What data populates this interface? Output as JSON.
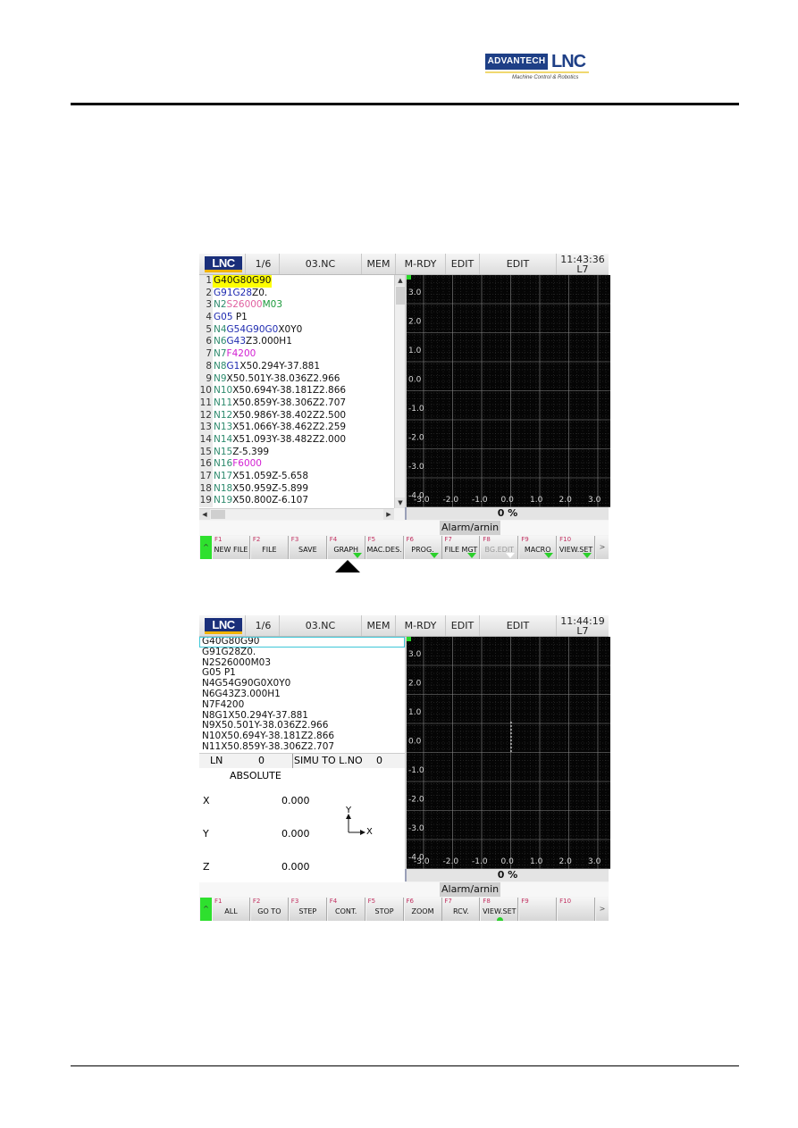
{
  "page": {
    "brand": {
      "company": "ADVANTECH",
      "product": "LNC",
      "tagline": "Machine Control & Robotics"
    }
  },
  "screen1": {
    "topbar": {
      "page": "1/6",
      "file": "03.NC",
      "source": "MEM",
      "status": "M-RDY",
      "mode": "EDIT",
      "mode_detail": "EDIT",
      "time": "11:43:36",
      "line": "L7"
    },
    "program": [
      {
        "no": "1",
        "tokens": [
          {
            "t": "G40G80G90",
            "c": "x"
          }
        ],
        "selected": true
      },
      {
        "no": "2",
        "tokens": [
          {
            "t": "G91G28",
            "c": "g"
          },
          {
            "t": "Z0.",
            "c": "x"
          }
        ]
      },
      {
        "no": "3",
        "tokens": [
          {
            "t": "N2",
            "c": "n"
          },
          {
            "t": "S26000",
            "c": "s"
          },
          {
            "t": "M03",
            "c": "m"
          }
        ]
      },
      {
        "no": "4",
        "tokens": [
          {
            "t": "G05 ",
            "c": "g"
          },
          {
            "t": "P1",
            "c": "x"
          }
        ]
      },
      {
        "no": "5",
        "tokens": [
          {
            "t": "N4",
            "c": "n"
          },
          {
            "t": "G54G90G0",
            "c": "g"
          },
          {
            "t": "X0Y0",
            "c": "x"
          }
        ]
      },
      {
        "no": "6",
        "tokens": [
          {
            "t": "N6",
            "c": "n"
          },
          {
            "t": "G43",
            "c": "g"
          },
          {
            "t": "Z3.000H1",
            "c": "x"
          }
        ]
      },
      {
        "no": "7",
        "tokens": [
          {
            "t": "N7",
            "c": "n"
          },
          {
            "t": "F4200",
            "c": "f"
          }
        ]
      },
      {
        "no": "8",
        "tokens": [
          {
            "t": "N8",
            "c": "n"
          },
          {
            "t": "G1",
            "c": "g"
          },
          {
            "t": "X50.294Y-37.881",
            "c": "x"
          }
        ]
      },
      {
        "no": "9",
        "tokens": [
          {
            "t": "N9",
            "c": "n"
          },
          {
            "t": "X50.501Y-38.036Z2.966",
            "c": "x"
          }
        ]
      },
      {
        "no": "10",
        "tokens": [
          {
            "t": "N10",
            "c": "n"
          },
          {
            "t": "X50.694Y-38.181Z2.866",
            "c": "x"
          }
        ]
      },
      {
        "no": "11",
        "tokens": [
          {
            "t": "N11",
            "c": "n"
          },
          {
            "t": "X50.859Y-38.306Z2.707",
            "c": "x"
          }
        ]
      },
      {
        "no": "12",
        "tokens": [
          {
            "t": "N12",
            "c": "n"
          },
          {
            "t": "X50.986Y-38.402Z2.500",
            "c": "x"
          }
        ]
      },
      {
        "no": "13",
        "tokens": [
          {
            "t": "N13",
            "c": "n"
          },
          {
            "t": "X51.066Y-38.462Z2.259",
            "c": "x"
          }
        ]
      },
      {
        "no": "14",
        "tokens": [
          {
            "t": "N14",
            "c": "n"
          },
          {
            "t": "X51.093Y-38.482Z2.000",
            "c": "x"
          }
        ]
      },
      {
        "no": "15",
        "tokens": [
          {
            "t": "N15",
            "c": "n"
          },
          {
            "t": "Z-5.399",
            "c": "x"
          }
        ]
      },
      {
        "no": "16",
        "tokens": [
          {
            "t": "N16",
            "c": "n"
          },
          {
            "t": "F6000",
            "c": "f"
          }
        ]
      },
      {
        "no": "17",
        "tokens": [
          {
            "t": "N17",
            "c": "n"
          },
          {
            "t": "X51.059Z-5.658",
            "c": "x"
          }
        ]
      },
      {
        "no": "18",
        "tokens": [
          {
            "t": "N18",
            "c": "n"
          },
          {
            "t": "X50.959Z-5.899",
            "c": "x"
          }
        ]
      },
      {
        "no": "19",
        "tokens": [
          {
            "t": "N19",
            "c": "n"
          },
          {
            "t": "X50.800Z-6.107",
            "c": "x"
          }
        ]
      }
    ],
    "graph": {
      "y_ticks": [
        "3.0",
        "2.0",
        "1.0",
        "0.0",
        "-1.0",
        "-2.0",
        "-3.0",
        "-4.0"
      ],
      "x_ticks": [
        "-3.0",
        "-2.0",
        "-1.0",
        "0.0",
        "1.0",
        "2.0",
        "3.0"
      ]
    },
    "progress": "0  %",
    "alarm": "Alarm/arnin",
    "softkeys": [
      {
        "fn": "F1",
        "label": "NEW FILE",
        "marker": ""
      },
      {
        "fn": "F2",
        "label": "FILE",
        "marker": ""
      },
      {
        "fn": "F3",
        "label": "SAVE",
        "marker": ""
      },
      {
        "fn": "F4",
        "label": "GRAPH",
        "marker": "green"
      },
      {
        "fn": "F5",
        "label": "MAC.DES.",
        "marker": ""
      },
      {
        "fn": "F6",
        "label": "PROG.",
        "marker": "green"
      },
      {
        "fn": "F7",
        "label": "FILE MGT",
        "marker": "green"
      },
      {
        "fn": "F8",
        "label": "BG.EDIT",
        "marker": "white",
        "disabled": true
      },
      {
        "fn": "F9",
        "label": "MACRO",
        "marker": "green"
      },
      {
        "fn": "F10",
        "label": "VIEW.SET",
        "marker": "green"
      }
    ],
    "up_label": "^",
    "more_label": ">"
  },
  "screen2": {
    "topbar": {
      "page": "1/6",
      "file": "03.NC",
      "source": "MEM",
      "status": "M-RDY",
      "mode": "EDIT",
      "mode_detail": "EDIT",
      "time": "11:44:19",
      "line": "L7"
    },
    "program": [
      "G40G80G90",
      "G91G28Z0.",
      "N2S26000M03",
      "G05 P1",
      "N4G54G90G0X0Y0",
      "N6G43Z3.000H1",
      "N7F4200",
      "N8G1X50.294Y-37.881",
      "N9X50.501Y-38.036Z2.966",
      "N10X50.694Y-38.181Z2.866",
      "N11X50.859Y-38.306Z2.707"
    ],
    "ln_label": "LN",
    "ln_value": "0",
    "simu_label": "SIMU TO L.NO",
    "simu_value": "0",
    "coord_title": "ABSOLUTE",
    "coords": [
      {
        "axis": "X",
        "value": "0.000"
      },
      {
        "axis": "Y",
        "value": "0.000"
      },
      {
        "axis": "Z",
        "value": "0.000"
      }
    ],
    "axis_icon": {
      "x": "X",
      "y": "Y"
    },
    "graph": {
      "y_ticks": [
        "3.0",
        "2.0",
        "1.0",
        "0.0",
        "-1.0",
        "-2.0",
        "-3.0",
        "-4.0"
      ],
      "x_ticks": [
        "-3.0",
        "-2.0",
        "-1.0",
        "0.0",
        "1.0",
        "2.0",
        "3.0"
      ]
    },
    "progress": "0  %",
    "alarm": "Alarm/arnin",
    "softkeys": [
      {
        "fn": "F1",
        "label": "ALL",
        "marker": ""
      },
      {
        "fn": "F2",
        "label": "GO TO",
        "marker": ""
      },
      {
        "fn": "F3",
        "label": "STEP",
        "marker": ""
      },
      {
        "fn": "F4",
        "label": "CONT.",
        "marker": ""
      },
      {
        "fn": "F5",
        "label": "STOP",
        "marker": ""
      },
      {
        "fn": "F6",
        "label": "ZOOM",
        "marker": ""
      },
      {
        "fn": "F7",
        "label": "RCV.",
        "marker": ""
      },
      {
        "fn": "F8",
        "label": "VIEW.SET",
        "marker": "dot"
      },
      {
        "fn": "F9",
        "label": "",
        "marker": ""
      },
      {
        "fn": "F10",
        "label": "",
        "marker": ""
      }
    ],
    "up_label": "^",
    "more_label": ">"
  }
}
